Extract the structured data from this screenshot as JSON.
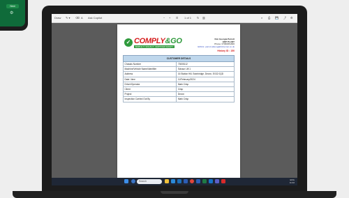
{
  "phone": {
    "next_label": "Next"
  },
  "pdf_toolbar": {
    "left_items": [
      "Draw",
      "Ask Copilot"
    ],
    "page_indicator": "1 of 1"
  },
  "document": {
    "company_name": "COMPLY",
    "company_suffix": "GO",
    "tagline": "SIMPLE IT. SOLVE IT. CERTIFIED SAFETY",
    "contact_lines": [
      "Kim Georgia Parrott",
      "EDP PLANT",
      "Phone: 07966051836",
      "EMAIL: parrott.alkeng@btinternet.co.uk"
    ],
    "history_label": "History ID : 150",
    "table_heading": "CUSTOMER DETAILS",
    "rows": [
      {
        "key": "Chassis Number",
        "value": "73005112"
      },
      {
        "key": "Machine/Vehicle Name/Identifier",
        "value": "Scissor Lift 1"
      },
      {
        "key": "Address",
        "value": "16 Station Hill, Swinbridge, Devon, EX32 0QD"
      },
      {
        "key": "Date / time",
        "value": "11/February/2024"
      },
      {
        "key": "Driver/Operator",
        "value": "Mark Crisp"
      },
      {
        "key": "Client",
        "value": "Crisp"
      },
      {
        "key": "Project",
        "value": "Devon"
      },
      {
        "key": "Inspection Carried Out By",
        "value": "Mark Crisp"
      }
    ]
  },
  "taskbar": {
    "search_placeholder": "Search",
    "sys_line1": "ENG",
    "sys_line2": "11:02",
    "icons": [
      "start-icon",
      "search-icon",
      "explorer-icon",
      "edge-icon",
      "store-icon",
      "mail-icon",
      "chrome-icon",
      "word-icon",
      "excel-icon",
      "outlook-icon",
      "teams-icon",
      "acrobat-icon"
    ]
  }
}
